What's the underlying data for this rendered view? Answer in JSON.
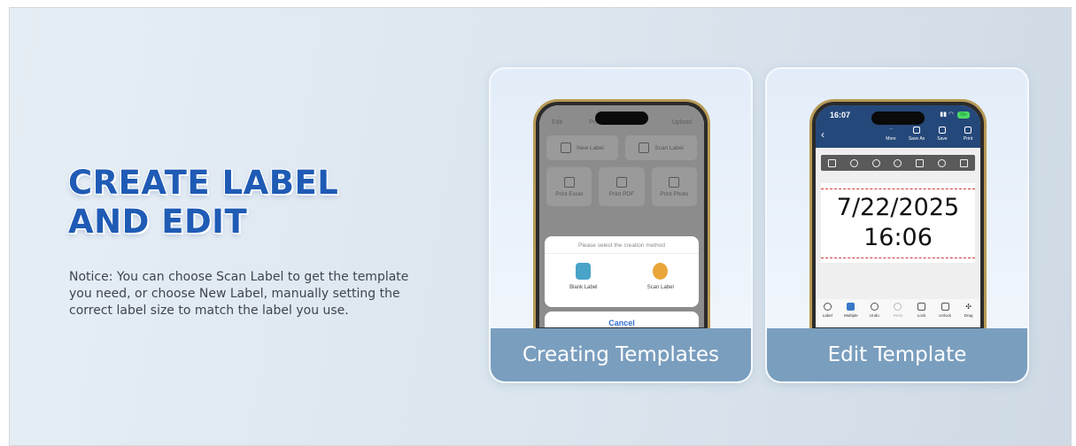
{
  "headline": {
    "line1": "CREATE LABEL",
    "line2": "AND EDIT"
  },
  "notice": "Notice: You can choose Scan Label to get the template you need, or choose New Label, manually setting the correct label size to match the label you use.",
  "cards": [
    {
      "caption": "Creating Templates",
      "screen": {
        "top_tabs": [
          "Edit",
          "Print",
          "Share",
          "Upload"
        ],
        "row1": [
          {
            "label": "New Label",
            "icon": "new-label-icon"
          },
          {
            "label": "Scan Label",
            "icon": "qr-icon"
          }
        ],
        "row2": [
          {
            "label": "Print Excel",
            "icon": "excel-icon"
          },
          {
            "label": "Print PDF",
            "icon": "pdf-icon"
          },
          {
            "label": "Print Photo",
            "icon": "photo-icon"
          }
        ],
        "sheet_title": "Please select the creation method",
        "options": [
          {
            "label": "Blank Label",
            "color": "#4aa3c8",
            "icon": "blank-label-icon"
          },
          {
            "label": "Scan Label",
            "color": "#e8a53a",
            "icon": "scan-label-icon"
          }
        ],
        "cancel": "Cancel"
      }
    },
    {
      "caption": "Edit Template",
      "screen": {
        "time": "16:07",
        "battery": "78+",
        "actions": [
          "More",
          "Save As",
          "Save",
          "Print"
        ],
        "label_line1": "7/22/2025",
        "label_line2": "16:06",
        "bottom_tools": [
          "Label",
          "Multiple",
          "Undo",
          "Redo",
          "Lock",
          "Unlock",
          "Drag"
        ]
      }
    }
  ]
}
